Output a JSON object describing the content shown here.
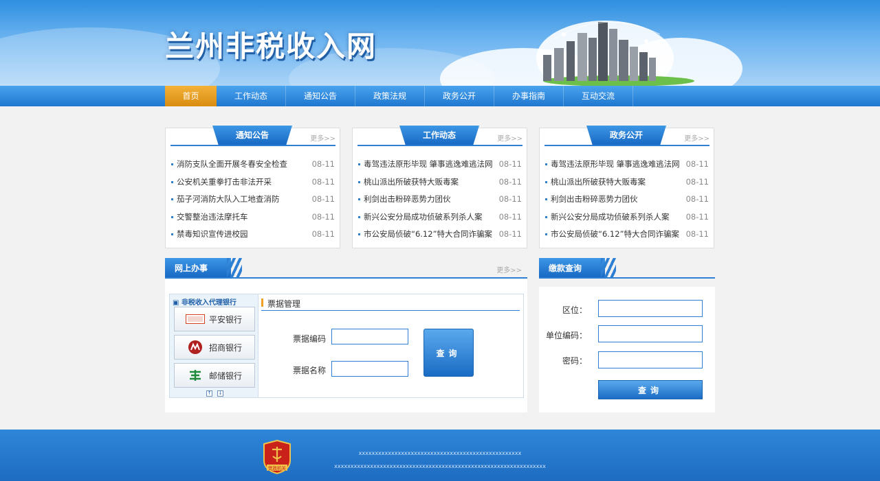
{
  "header": {
    "site_title": "兰州非税收入网"
  },
  "nav": {
    "items": [
      {
        "label": "首页"
      },
      {
        "label": "工作动态"
      },
      {
        "label": "通知公告"
      },
      {
        "label": "政策法规"
      },
      {
        "label": "政务公开"
      },
      {
        "label": "办事指南"
      },
      {
        "label": "互动交流"
      }
    ]
  },
  "news_boxes": [
    {
      "title": "通知公告",
      "more": "更多>>",
      "items": [
        {
          "text": "消防支队全面开展冬春安全检查",
          "date": "08-11"
        },
        {
          "text": "公安机关重拳打击非法开采",
          "date": "08-11"
        },
        {
          "text": "茄子河消防大队入工地查消防",
          "date": "08-11"
        },
        {
          "text": "交警整治违法摩托车",
          "date": "08-11"
        },
        {
          "text": "禁毒知识宣传进校园",
          "date": "08-11"
        }
      ]
    },
    {
      "title": "工作动态",
      "more": "更多>>",
      "items": [
        {
          "text": "毒驾违法原形毕现 肇事逃逸难逃法网",
          "date": "08-11"
        },
        {
          "text": "桃山派出所破获特大贩毒案",
          "date": "08-11"
        },
        {
          "text": "利剑出击粉碎恶势力团伙",
          "date": "08-11"
        },
        {
          "text": "新兴公安分局成功侦破系列杀人案",
          "date": "08-11"
        },
        {
          "text": "市公安局侦破“6.12”特大合同诈骗案",
          "date": "08-11"
        }
      ]
    },
    {
      "title": "政务公开",
      "more": "更多>>",
      "items": [
        {
          "text": "毒驾违法原形毕现 肇事逃逸难逃法网",
          "date": "08-11"
        },
        {
          "text": "桃山派出所破获特大贩毒案",
          "date": "08-11"
        },
        {
          "text": "利剑出击粉碎恶势力团伙",
          "date": "08-11"
        },
        {
          "text": "新兴公安分局成功侦破系列杀人案",
          "date": "08-11"
        },
        {
          "text": "市公安局侦破“6.12”特大合同诈骗案",
          "date": "08-11"
        }
      ]
    }
  ],
  "online_service": {
    "title": "网上办事",
    "more": "更多>>",
    "bank_title": "非税收入代理银行",
    "banks": [
      {
        "name": "平安银行",
        "logo_text": "中国平安",
        "color": "#d9401e"
      },
      {
        "name": "招商银行",
        "color": "#b0201e"
      },
      {
        "name": "邮储银行",
        "color": "#1f8a3b"
      }
    ],
    "arrow_up": "↑",
    "arrow_down": "↓",
    "ticket": {
      "title": "票据管理",
      "code_label": "票据编码",
      "name_label": "票据名称",
      "query_label": "查询"
    }
  },
  "payment": {
    "title": "缴款查询",
    "area_label": "区位：",
    "unit_label": "单位编码：",
    "password_label": "密码：",
    "query_label": "查询"
  },
  "footer": {
    "badge_text": "党政机关",
    "line1": "xxxxxxxxxxxxxxxxxxxxxxxxxxxxxxxxxxxxxxxxxxxxxxxxxx",
    "line2": "xxxxxxxxxxxxxxxxxxxxxxxxxxxxxxxxxxxxxxxxxxxxxxxxxxxxxxxxxxxxxxxxx"
  },
  "colors": {
    "accent": "#2d7fd4",
    "nav_active": "#e69b1c",
    "footer": "#1d6cc1"
  }
}
